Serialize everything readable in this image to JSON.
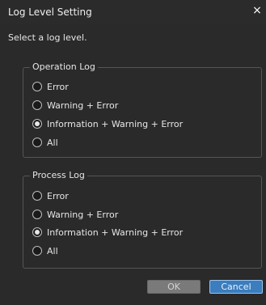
{
  "dialog": {
    "title": "Log Level Setting",
    "close_glyph": "×",
    "prompt": "Select a log level."
  },
  "operation_log": {
    "legend": "Operation Log",
    "options": [
      {
        "label": "Error",
        "checked": false
      },
      {
        "label": "Warning + Error",
        "checked": false
      },
      {
        "label": "Information + Warning + Error",
        "checked": true
      },
      {
        "label": "All",
        "checked": false
      }
    ]
  },
  "process_log": {
    "legend": "Process Log",
    "options": [
      {
        "label": "Error",
        "checked": false
      },
      {
        "label": "Warning + Error",
        "checked": false
      },
      {
        "label": "Information + Warning + Error",
        "checked": true
      },
      {
        "label": "All",
        "checked": false
      }
    ]
  },
  "buttons": {
    "ok": "OK",
    "cancel": "Cancel"
  },
  "colors": {
    "background": "#2a2a2a",
    "border": "#555555",
    "accent": "#3b7dbd"
  },
  "icons": {
    "close": "close-icon"
  }
}
